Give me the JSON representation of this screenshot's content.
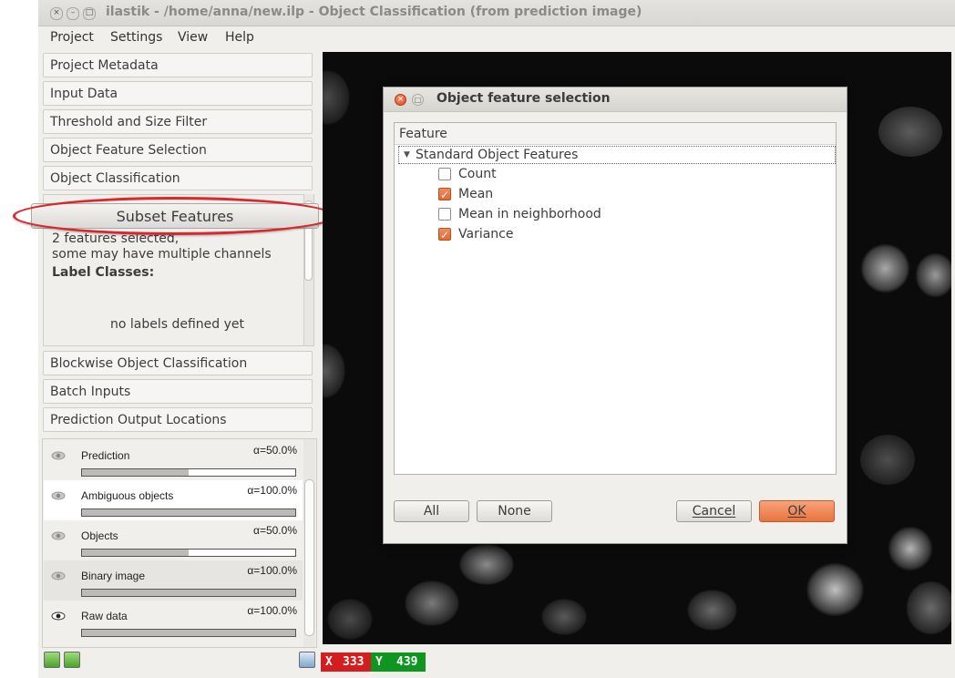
{
  "window": {
    "title": "ilastik - /home/anna/new.ilp - Object Classification (from prediction image)",
    "close_glyph": "×",
    "minimize_glyph": "–",
    "maximize_glyph": "□"
  },
  "menubar": {
    "items": [
      {
        "label": "Project",
        "mnemonic": "P"
      },
      {
        "label": "Settings",
        "mnemonic": "S"
      },
      {
        "label": "View",
        "mnemonic": ""
      },
      {
        "label": "Help",
        "mnemonic": "H"
      }
    ]
  },
  "applets": [
    "Project Metadata",
    "Input Data",
    "Threshold and Size Filter",
    "Object Feature Selection",
    "Object Classification",
    "Blockwise Object Classification",
    "Batch Inputs",
    "Prediction Output Locations"
  ],
  "object_classification": {
    "subset_button": "Subset Features",
    "selected_line1": "2 features selected,",
    "selected_line2": "some may have multiple channels",
    "label_classes_heading": "Label Classes:",
    "no_labels": "no labels defined yet"
  },
  "layers": [
    {
      "name": "Prediction",
      "alpha": "α=50.0%",
      "opacity": 0.5,
      "eye": "eye-dim",
      "highlight": false
    },
    {
      "name": "Ambiguous objects",
      "alpha": "α=100.0%",
      "opacity": 1.0,
      "eye": "eye-dim",
      "highlight": true
    },
    {
      "name": "Objects",
      "alpha": "α=50.0%",
      "opacity": 0.5,
      "eye": "eye-dim",
      "highlight": false
    },
    {
      "name": "Binary image",
      "alpha": "α=100.0%",
      "opacity": 1.0,
      "eye": "eye-dim",
      "highlight": false
    },
    {
      "name": "Raw data",
      "alpha": "α=100.0%",
      "opacity": 1.0,
      "eye": "eye-open",
      "highlight": false
    }
  ],
  "dialog": {
    "title": "Object feature selection",
    "column_header": "Feature",
    "group": "Standard Object Features",
    "features": [
      {
        "label": "Count",
        "checked": false
      },
      {
        "label": "Mean",
        "checked": true
      },
      {
        "label": "Mean in neighborhood",
        "checked": false
      },
      {
        "label": "Variance",
        "checked": true
      }
    ],
    "buttons": {
      "all": "All",
      "none": "None",
      "cancel": "Cancel",
      "ok": "OK"
    }
  },
  "position": {
    "x_label": "X",
    "x_value": "333",
    "y_label": "Y",
    "y_value": "439"
  },
  "colors": {
    "highlight_ellipse": "#d9272b",
    "ok_button": "#e8743f",
    "x_badge": "#d21e1e",
    "y_badge": "#0f9620",
    "checkbox_checked": "#e6672f"
  }
}
